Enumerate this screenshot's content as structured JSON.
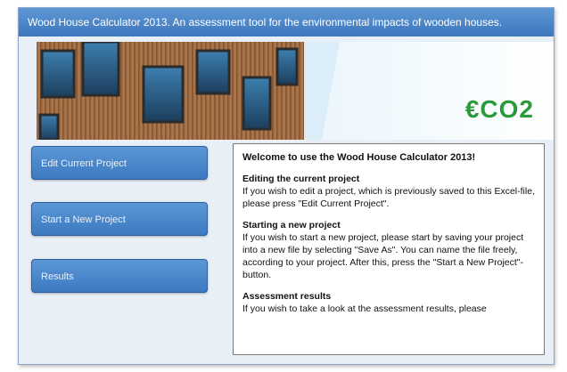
{
  "window": {
    "title": "Wood House Calculator 2013. An assessment tool for the environmental impacts of wooden houses."
  },
  "banner": {
    "logo_text": "€CO2"
  },
  "sidebar": {
    "buttons": [
      {
        "label": "Edit Current Project"
      },
      {
        "label": "Start a New Project"
      },
      {
        "label": "Results"
      }
    ]
  },
  "panel": {
    "heading": "Welcome to use the Wood House Calculator 2013!",
    "sections": [
      {
        "title": "Editing the current project",
        "text": "If you wish to edit a project, which is previously saved to this Excel-file, please press \"Edit Current Project\"."
      },
      {
        "title": "Starting a new project",
        "text": "If you wish to start a new project, please start by saving your project into a new file by selecting \"Save As\". You can name the file freely, according to your project. After this, press the \"Start a New Project\"-button."
      },
      {
        "title": "Assessment results",
        "text": "If you wish to take a look at the assessment results, please"
      }
    ]
  },
  "colors": {
    "titlebar": "#4a86c8",
    "button": "#4a88cc",
    "logo": "#2a9a3a"
  }
}
